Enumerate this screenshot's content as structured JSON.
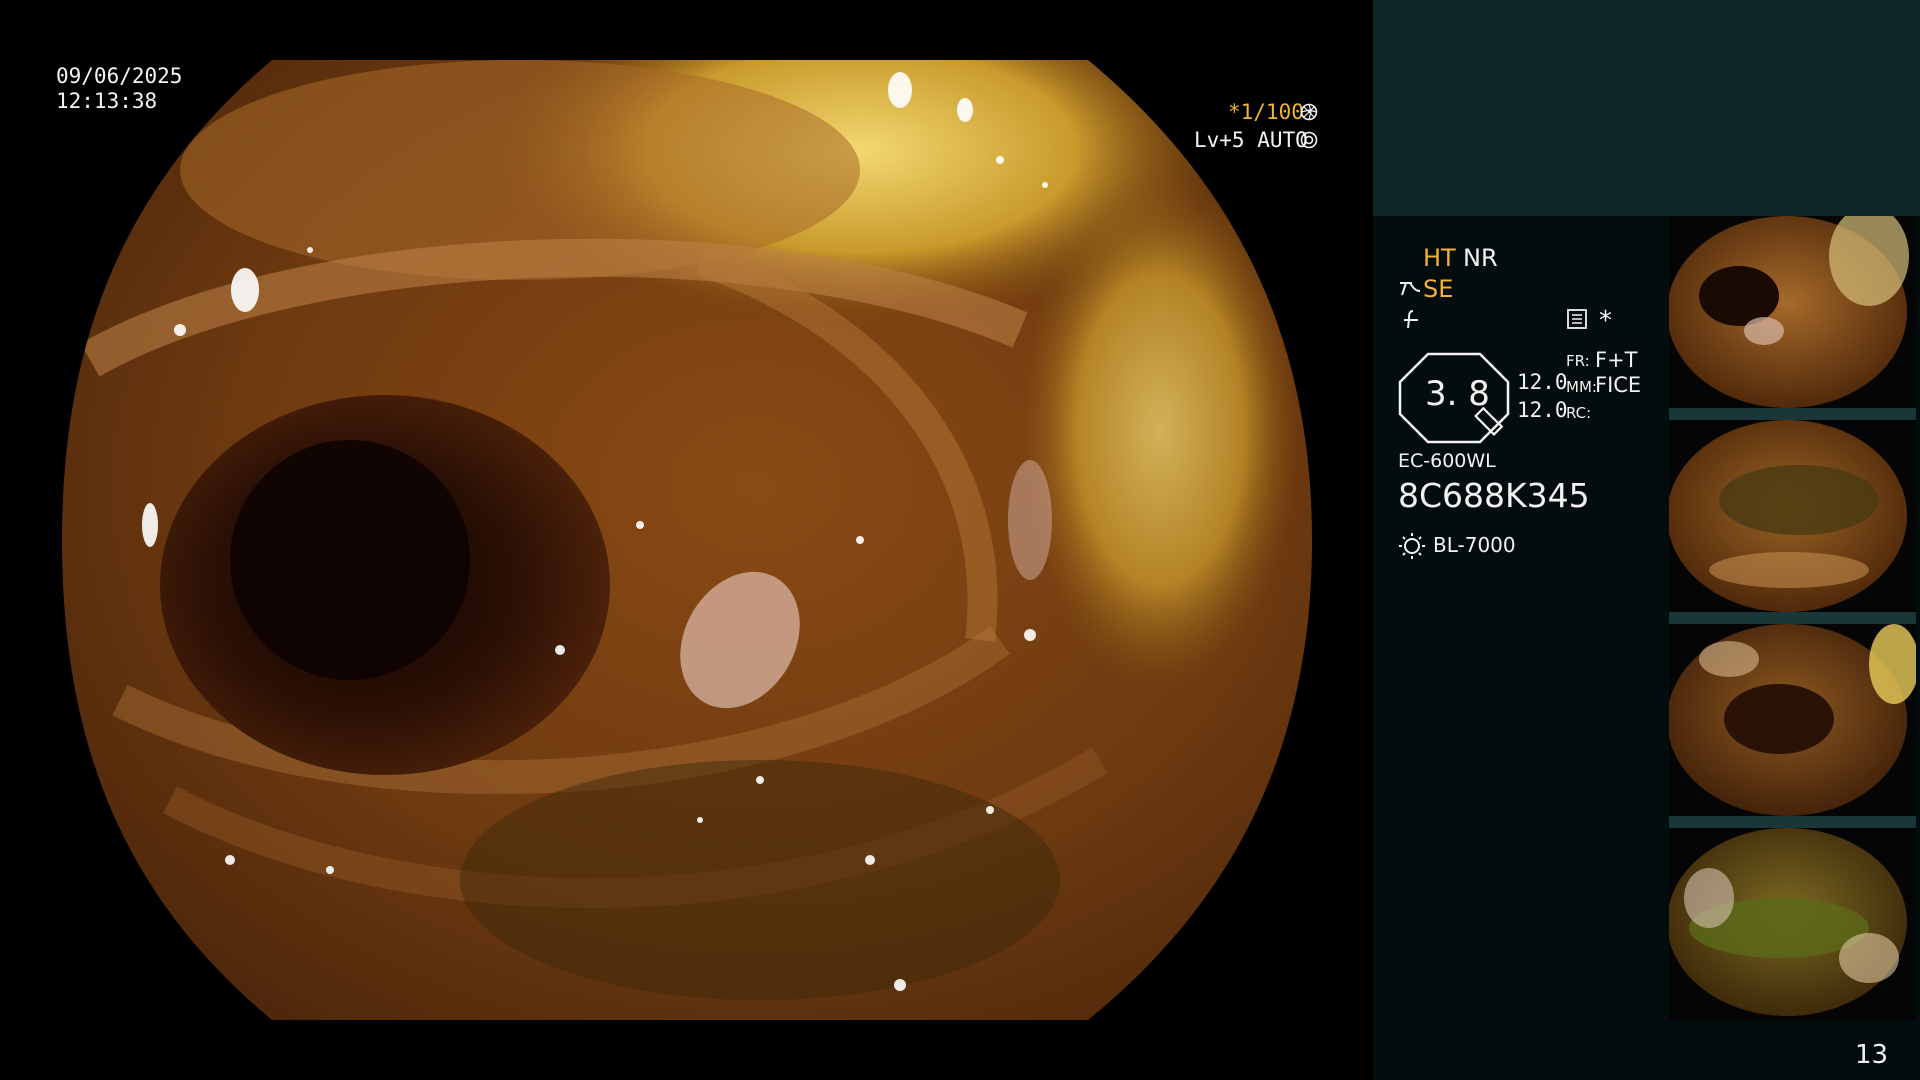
{
  "overlay": {
    "date": "09/06/2025",
    "time": "12:13:38",
    "shutter": "*1/100",
    "level": "Lv+5 AUTO",
    "shutter_icon": "aperture-icon",
    "level_icon": "iris-icon"
  },
  "panel": {
    "ht": "HT",
    "nr": "NR",
    "se": "SE",
    "se_icon": "enhance-icon",
    "filter_icon": "contrast-icon",
    "menu_icon": "settings-list-icon",
    "asterisk": "*",
    "zoom": "3. 8",
    "value_1": "12.0",
    "value_2": "12.0",
    "fr_label": "FR:",
    "fr_value": "F+T",
    "mm_label": "MM:",
    "mm_value": "FICE",
    "rc_label": "RC:",
    "scope_model": "EC-600WL",
    "serial": "8C688K345",
    "light_icon": "light-source-icon",
    "light_source": "BL-7000",
    "page_number": "13"
  },
  "thumbnails": [
    {
      "name": "thumbnail-1"
    },
    {
      "name": "thumbnail-2"
    },
    {
      "name": "thumbnail-3"
    },
    {
      "name": "thumbnail-4"
    }
  ],
  "colors": {
    "panel_top": "#0d2729",
    "panel_bg": "#030d0e",
    "accent_orange": "#f3b233"
  }
}
